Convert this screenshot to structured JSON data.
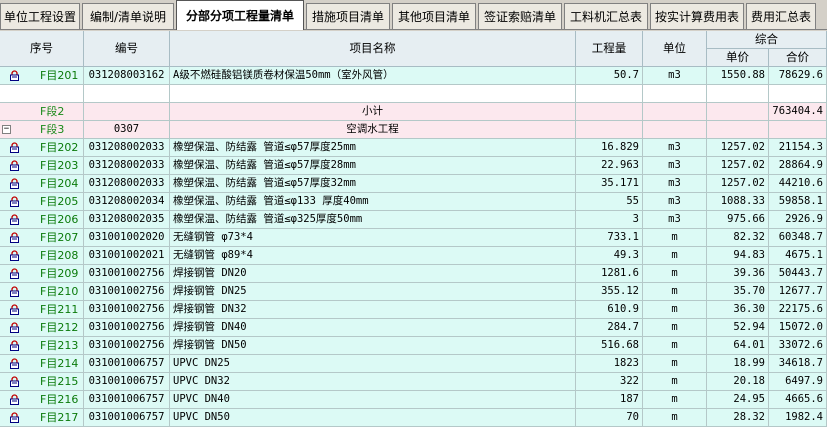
{
  "tabs": [
    "单位工程设置",
    "编制/清单说明",
    "分部分项工程量清单",
    "措施项目清单",
    "其他项目清单",
    "签证索赔清单",
    "工料机汇总表",
    "按实计算费用表",
    "费用汇总表"
  ],
  "active_tab": 2,
  "header": {
    "seq": "序号",
    "code": "编号",
    "name": "项目名称",
    "qty": "工程量",
    "unit": "单位",
    "group": "综合",
    "price": "单价",
    "total": "合价"
  },
  "rows": [
    {
      "type": "item",
      "seq": "F目201",
      "code": "031208003162",
      "name": "A级不燃硅酸铝镁质卷材保温50mm（室外风管）",
      "qty": "50.7",
      "unit": "m3",
      "price": "1550.88",
      "total": "78629.6"
    },
    {
      "type": "blank",
      "seq": "",
      "code": "",
      "name": "",
      "qty": "",
      "unit": "",
      "price": "",
      "total": ""
    },
    {
      "type": "seg",
      "seq": "F段2",
      "code": "",
      "name": "小计",
      "qty": "",
      "unit": "",
      "price": "",
      "total": "763404.4"
    },
    {
      "type": "seg",
      "seq": "F段3",
      "code": "0307",
      "name": "空调水工程",
      "qty": "",
      "unit": "",
      "price": "",
      "total": ""
    },
    {
      "type": "item",
      "seq": "F目202",
      "code": "031208002033",
      "name": "橡塑保温、防结露 管道≤φ57厚度25mm",
      "qty": "16.829",
      "unit": "m3",
      "price": "1257.02",
      "total": "21154.3"
    },
    {
      "type": "item",
      "seq": "F目203",
      "code": "031208002033",
      "name": "橡塑保温、防结露 管道≤φ57厚度28mm",
      "qty": "22.963",
      "unit": "m3",
      "price": "1257.02",
      "total": "28864.9"
    },
    {
      "type": "item",
      "seq": "F目204",
      "code": "031208002033",
      "name": "橡塑保温、防结露 管道≤φ57厚度32mm",
      "qty": "35.171",
      "unit": "m3",
      "price": "1257.02",
      "total": "44210.6"
    },
    {
      "type": "item",
      "seq": "F目205",
      "code": "031208002034",
      "name": "橡塑保温、防结露 管道≤φ133 厚度40mm",
      "qty": "55",
      "unit": "m3",
      "price": "1088.33",
      "total": "59858.1"
    },
    {
      "type": "item",
      "seq": "F目206",
      "code": "031208002035",
      "name": "橡塑保温、防结露 管道≤φ325厚度50mm",
      "qty": "3",
      "unit": "m3",
      "price": "975.66",
      "total": "2926.9"
    },
    {
      "type": "item",
      "seq": "F目207",
      "code": "031001002020",
      "name": "无缝钢管 φ73*4",
      "qty": "733.1",
      "unit": "m",
      "price": "82.32",
      "total": "60348.7"
    },
    {
      "type": "item",
      "seq": "F目208",
      "code": "031001002021",
      "name": "无缝钢管 φ89*4",
      "qty": "49.3",
      "unit": "m",
      "price": "94.83",
      "total": "4675.1"
    },
    {
      "type": "item",
      "seq": "F目209",
      "code": "031001002756",
      "name": "焊接钢管 DN20",
      "qty": "1281.6",
      "unit": "m",
      "price": "39.36",
      "total": "50443.7"
    },
    {
      "type": "item",
      "seq": "F目210",
      "code": "031001002756",
      "name": "焊接钢管 DN25",
      "qty": "355.12",
      "unit": "m",
      "price": "35.70",
      "total": "12677.7"
    },
    {
      "type": "item",
      "seq": "F目211",
      "code": "031001002756",
      "name": "焊接钢管 DN32",
      "qty": "610.9",
      "unit": "m",
      "price": "36.30",
      "total": "22175.6"
    },
    {
      "type": "item",
      "seq": "F目212",
      "code": "031001002756",
      "name": "焊接钢管 DN40",
      "qty": "284.7",
      "unit": "m",
      "price": "52.94",
      "total": "15072.0"
    },
    {
      "type": "item",
      "seq": "F目213",
      "code": "031001002756",
      "name": "焊接钢管 DN50",
      "qty": "516.68",
      "unit": "m",
      "price": "64.01",
      "total": "33072.6"
    },
    {
      "type": "item",
      "seq": "F目214",
      "code": "031001006757",
      "name": "UPVC DN25",
      "qty": "1823",
      "unit": "m",
      "price": "18.99",
      "total": "34618.7"
    },
    {
      "type": "item",
      "seq": "F目215",
      "code": "031001006757",
      "name": "UPVC DN32",
      "qty": "322",
      "unit": "m",
      "price": "20.18",
      "total": "6497.9"
    },
    {
      "type": "item",
      "seq": "F目216",
      "code": "031001006757",
      "name": "UPVC DN40",
      "qty": "187",
      "unit": "m",
      "price": "24.95",
      "total": "4665.6"
    },
    {
      "type": "item",
      "seq": "F目217",
      "code": "031001006757",
      "name": "UPVC DN50",
      "qty": "70",
      "unit": "m",
      "price": "28.32",
      "total": "1982.4"
    }
  ]
}
